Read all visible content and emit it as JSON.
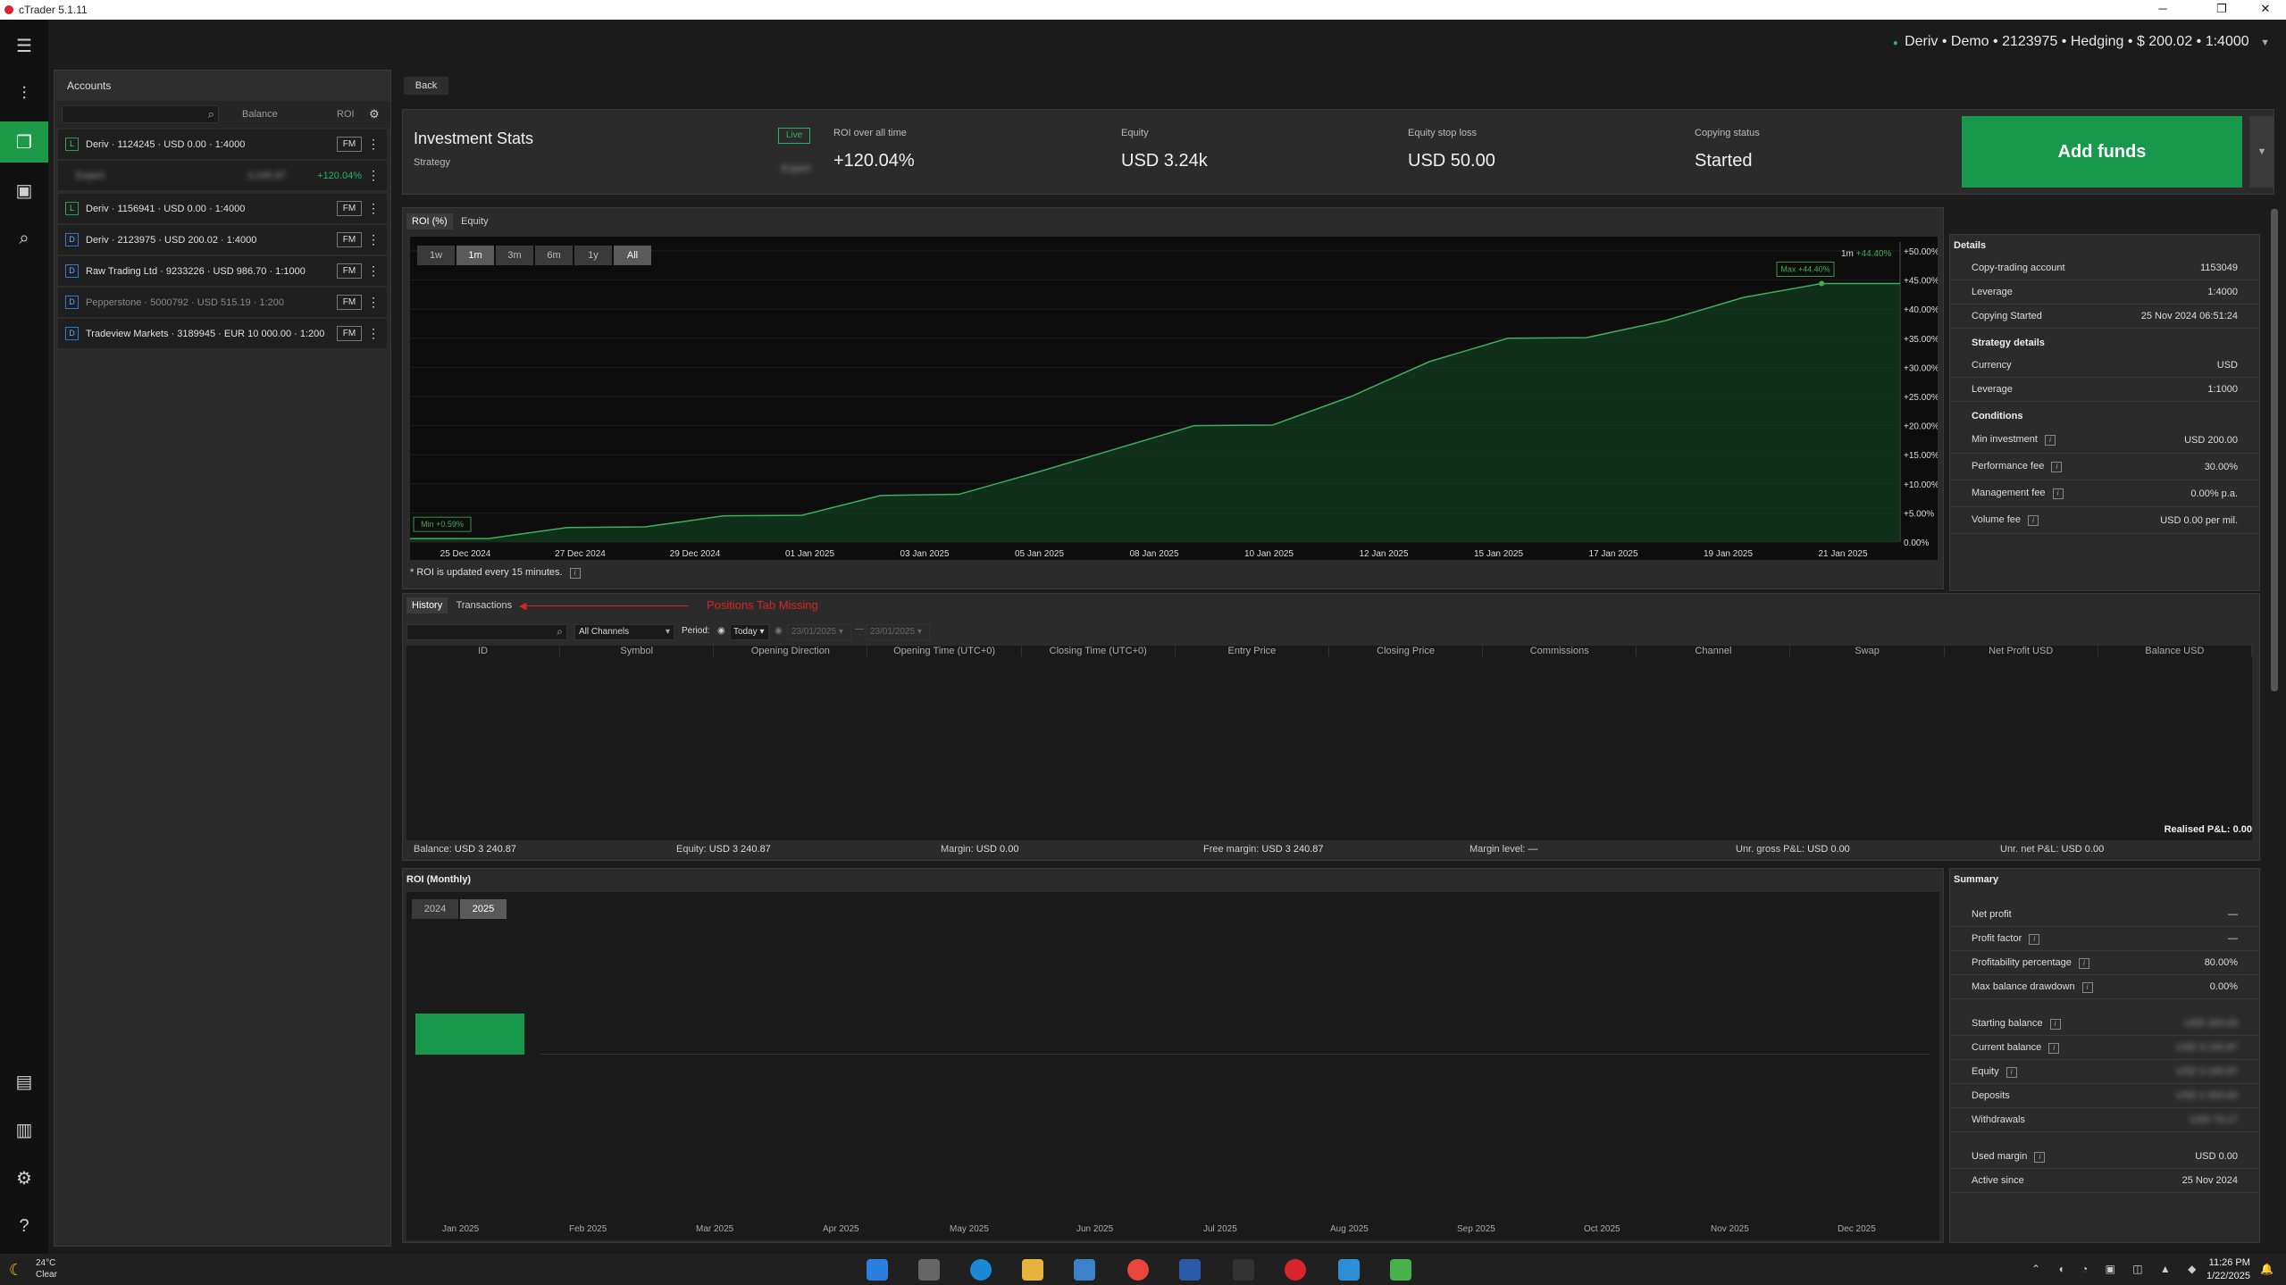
{
  "window": {
    "title": "cTrader 5.1.11",
    "minimize": "─",
    "maximize": "❐",
    "close": "✕"
  },
  "topbar": {
    "account_summary": "Deriv • Demo • 2123975 • Hedging • $ 200.02 • 1:4000"
  },
  "nav": {
    "back": "Back"
  },
  "accounts_panel": {
    "title": "Accounts",
    "columns": {
      "balance": "Balance",
      "roi": "ROI"
    },
    "items": [
      {
        "tag": "L",
        "label": "Deriv · 1124245 · USD 0.00 · 1:4000",
        "fm": "FM"
      },
      {
        "tag": "L",
        "label": "Expert",
        "balance": "3,245.87",
        "roi": "+120.04%"
      },
      {
        "tag": "L",
        "label": "Deriv · 1156941 · USD 0.00 · 1:4000",
        "fm": "FM"
      },
      {
        "tag": "D",
        "label": "Deriv · 2123975 · USD 200.02 · 1:4000",
        "fm": "FM"
      },
      {
        "tag": "D",
        "label": "Raw Trading Ltd · 9233226 · USD 986.70 · 1:1000",
        "fm": "FM"
      },
      {
        "tag": "D",
        "label": "Pepperstone · 5000792 · USD 515.19 · 1:200",
        "fm": "FM"
      },
      {
        "tag": "D",
        "label": "Tradeview Markets · 3189945 · EUR 10 000.00 · 1:200",
        "fm": "FM"
      }
    ]
  },
  "stats": {
    "title": "Investment Stats",
    "subtitle": "Strategy",
    "live_badge": "Live",
    "strategy_name": "Expert",
    "roi_label": "ROI over all time",
    "roi_value": "+120.04%",
    "equity_label": "Equity",
    "equity_value": "USD 3.24k",
    "stoploss_label": "Equity stop loss",
    "stoploss_value": "USD 50.00",
    "copying_label": "Copying status",
    "copying_value": "Started",
    "add_funds": "Add funds"
  },
  "chart_tabs": [
    "ROI (%)",
    "Equity"
  ],
  "range_buttons": [
    "1w",
    "1m",
    "3m",
    "6m",
    "1y",
    "All"
  ],
  "roi_note": "* ROI is updated every 15 minutes.",
  "chart_data": {
    "type": "area",
    "x": [
      "25 Dec 2024",
      "27 Dec 2024",
      "29 Dec 2024",
      "01 Jan 2025",
      "03 Jan 2025",
      "05 Jan 2025",
      "08 Jan 2025",
      "10 Jan 2025",
      "12 Jan 2025",
      "15 Jan 2025",
      "17 Jan 2025",
      "19 Jan 2025",
      "21 Jan 2025"
    ],
    "yticks": [
      "+50.00%",
      "+45.00%",
      "+40.00%",
      "+35.00%",
      "+30.00%",
      "+25.00%",
      "+20.00%",
      "+15.00%",
      "+10.00%",
      "+5.00%",
      "0.00%"
    ],
    "series": [
      {
        "values": [
          0.59,
          0.6,
          2.5,
          2.6,
          4.5,
          4.6,
          8,
          8.2,
          12,
          16,
          20,
          20.1,
          25,
          31,
          35,
          35.1,
          38,
          42,
          44.4,
          44.4
        ]
      }
    ],
    "ylim": [
      0,
      50
    ],
    "min_label": "Min +0.59%",
    "max_label": "Max +44.40%",
    "current_range": "1m",
    "current_value": "+44.40%",
    "color": "#3fae5a"
  },
  "details": {
    "title": "Details",
    "rows": [
      {
        "k": "Copy-trading account",
        "v": "1153049"
      },
      {
        "k": "Leverage",
        "v": "1:4000"
      },
      {
        "k": "Copying Started",
        "v": "25 Nov 2024 06:51:24"
      }
    ],
    "strategy_title": "Strategy details",
    "strategy_rows": [
      {
        "k": "Currency",
        "v": "USD"
      },
      {
        "k": "Leverage",
        "v": "1:1000"
      }
    ],
    "conditions_title": "Conditions",
    "condition_rows": [
      {
        "k": "Min investment",
        "v": "USD 200.00"
      },
      {
        "k": "Performance fee",
        "v": "30.00%"
      },
      {
        "k": "Management fee",
        "v": "0.00% p.a."
      },
      {
        "k": "Volume fee",
        "v": "USD 0.00 per mil."
      }
    ]
  },
  "history": {
    "tabs": [
      "History",
      "Transactions"
    ],
    "annotation": "Positions Tab Missing",
    "channel": "All Channels",
    "period_label": "Period:",
    "period_value": "Today",
    "date_from": "23/01/2025",
    "date_to": "23/01/2025",
    "columns": [
      "ID",
      "Symbol",
      "Opening Direction",
      "Opening Time (UTC+0)",
      "Closing Time (UTC+0)",
      "Entry Price",
      "Closing Price",
      "Commissions",
      "Channel",
      "Swap",
      "Net Profit USD",
      "Balance USD"
    ],
    "realised": "Realised P&L:  0.00",
    "footer": [
      {
        "k": "Balance:",
        "v": "USD 3 240.87"
      },
      {
        "k": "Equity:",
        "v": "USD 3 240.87"
      },
      {
        "k": "Margin:",
        "v": "USD 0.00"
      },
      {
        "k": "Free margin:",
        "v": "USD 3 240.87"
      },
      {
        "k": "Margin level:",
        "v": "—"
      },
      {
        "k": "Unr. gross P&L:",
        "v": "USD 0.00"
      },
      {
        "k": "Unr. net P&L:",
        "v": "USD 0.00"
      }
    ]
  },
  "monthly": {
    "title": "ROI (Monthly)",
    "years": [
      "2024",
      "2025"
    ],
    "months": [
      "Jan 2025",
      "Feb 2025",
      "Mar 2025",
      "Apr 2025",
      "May 2025",
      "Jun 2025",
      "Jul 2025",
      "Aug 2025",
      "Sep 2025",
      "Oct 2025",
      "Nov 2025",
      "Dec 2025"
    ]
  },
  "summary": {
    "title": "Summary",
    "rows": [
      {
        "k": "Net profit",
        "v": "—"
      },
      {
        "k": "Profit factor",
        "v": "—",
        "i": true
      },
      {
        "k": "Profitability percentage",
        "v": "80.00%",
        "i": true
      },
      {
        "k": "Max balance drawdown",
        "v": "0.00%",
        "i": true
      }
    ],
    "rows2": [
      {
        "k": "Starting balance",
        "v": "USD 200.00",
        "i": true
      },
      {
        "k": "Current balance",
        "v": "USD 3 240.87",
        "i": true
      },
      {
        "k": "Equity",
        "v": "USD 3 240.87",
        "i": true
      },
      {
        "k": "Deposits",
        "v": "USD 1 000.00"
      },
      {
        "k": "Withdrawals",
        "v": "USD 76.17"
      }
    ],
    "rows3": [
      {
        "k": "Used margin",
        "v": "USD 0.00",
        "i": true
      },
      {
        "k": "Active since",
        "v": "25 Nov 2024"
      }
    ]
  },
  "taskbar": {
    "temp": "24°C",
    "weather": "Clear",
    "time": "11:26 PM",
    "date": "1/22/2025"
  }
}
